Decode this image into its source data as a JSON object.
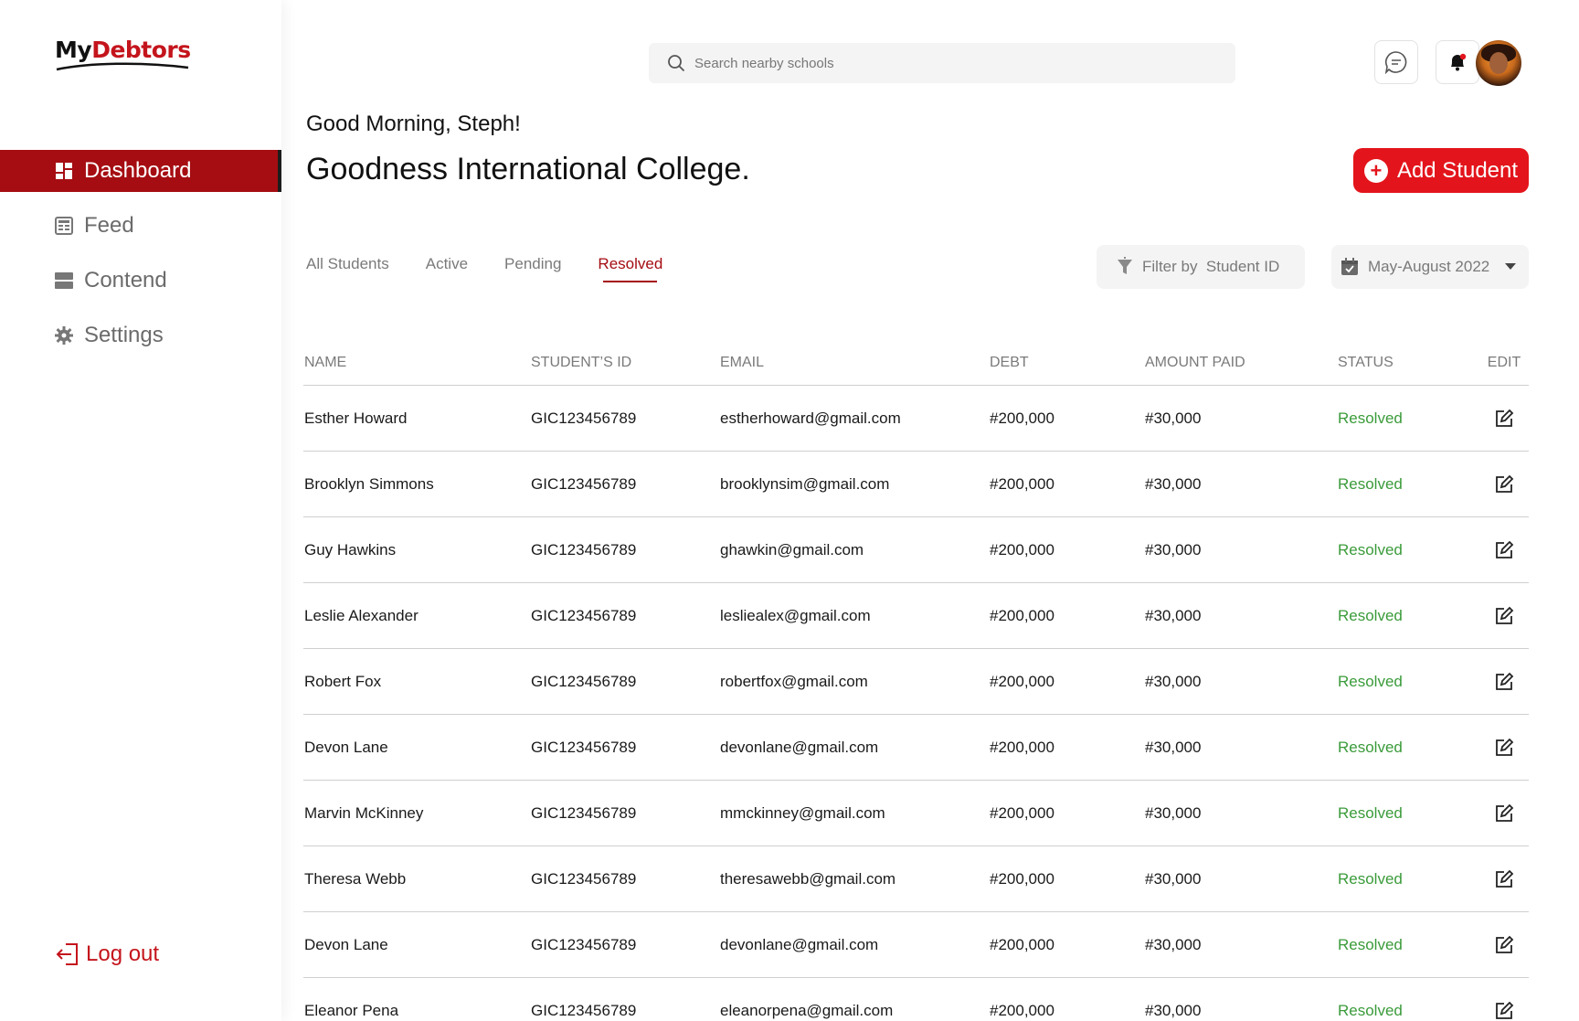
{
  "logo": {
    "prefix": "My",
    "rest": "Debtors"
  },
  "sidebar": {
    "items": [
      {
        "label": "Dashboard",
        "icon": "dashboard-icon"
      },
      {
        "label": "Feed",
        "icon": "feed-icon"
      },
      {
        "label": "Contend",
        "icon": "contend-icon"
      },
      {
        "label": "Settings",
        "icon": "gear-icon"
      }
    ],
    "logout_label": "Log out"
  },
  "header": {
    "search_placeholder": "Search nearby schools",
    "greeting": "Good Morning, Steph!",
    "college": "Goodness International College.",
    "add_student_label": "Add Student"
  },
  "tabs": [
    {
      "label": "All Students"
    },
    {
      "label": "Active"
    },
    {
      "label": "Pending"
    },
    {
      "label": "Resolved",
      "active": true
    }
  ],
  "filter": {
    "label": "Filter by  Student ID"
  },
  "date_range": {
    "value": "May-August 2022"
  },
  "colors": {
    "accent": "#a50d12",
    "brand": "#e3141b",
    "resolved": "#3a9b3a"
  },
  "table": {
    "columns": [
      "NAME",
      "STUDENT’S ID",
      "EMAIL",
      "DEBT",
      "AMOUNT PAID",
      "STATUS",
      "EDIT"
    ],
    "rows": [
      {
        "name": "Esther Howard",
        "id": "GIC123456789",
        "email": "estherhoward@gmail.com",
        "debt": "#200,000",
        "paid": "#30,000",
        "status": "Resolved"
      },
      {
        "name": "Brooklyn Simmons",
        "id": "GIC123456789",
        "email": "brooklynsim@gmail.com",
        "debt": "#200,000",
        "paid": "#30,000",
        "status": "Resolved"
      },
      {
        "name": "Guy Hawkins",
        "id": "GIC123456789",
        "email": "ghawkin@gmail.com",
        "debt": "#200,000",
        "paid": "#30,000",
        "status": "Resolved"
      },
      {
        "name": "Leslie Alexander",
        "id": "GIC123456789",
        "email": "lesliealex@gmail.com",
        "debt": "#200,000",
        "paid": "#30,000",
        "status": "Resolved"
      },
      {
        "name": "Robert Fox",
        "id": "GIC123456789",
        "email": "robertfox@gmail.com",
        "debt": "#200,000",
        "paid": "#30,000",
        "status": "Resolved"
      },
      {
        "name": "Devon Lane",
        "id": "GIC123456789",
        "email": "devonlane@gmail.com",
        "debt": "#200,000",
        "paid": "#30,000",
        "status": "Resolved"
      },
      {
        "name": "Marvin McKinney",
        "id": "GIC123456789",
        "email": "mmckinney@gmail.com",
        "debt": "#200,000",
        "paid": "#30,000",
        "status": "Resolved"
      },
      {
        "name": "Theresa Webb",
        "id": "GIC123456789",
        "email": "theresawebb@gmail.com",
        "debt": "#200,000",
        "paid": "#30,000",
        "status": "Resolved"
      },
      {
        "name": "Devon Lane",
        "id": "GIC123456789",
        "email": "devonlane@gmail.com",
        "debt": "#200,000",
        "paid": "#30,000",
        "status": "Resolved"
      },
      {
        "name": "Eleanor Pena",
        "id": "GIC123456789",
        "email": "eleanorpena@gmail.com",
        "debt": "#200,000",
        "paid": "#30,000",
        "status": "Resolved"
      }
    ]
  }
}
